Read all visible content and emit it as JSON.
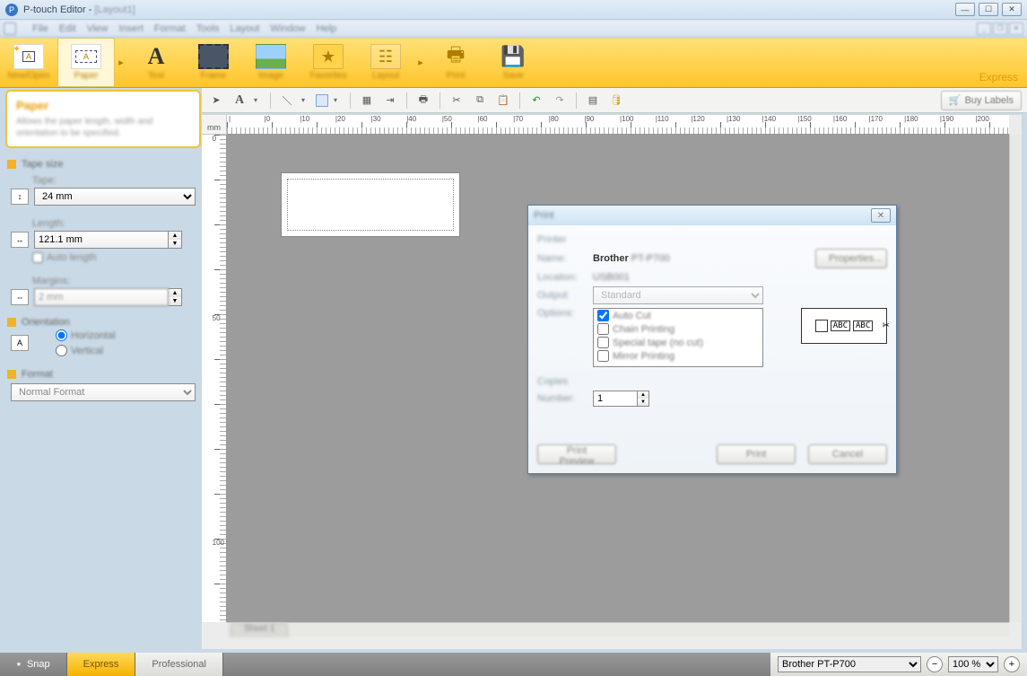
{
  "titlebar": {
    "app": "P-touch Editor",
    "doc": "[Layout1]"
  },
  "menus": [
    "File",
    "Edit",
    "View",
    "Insert",
    "Format",
    "Tools",
    "Layout",
    "Window",
    "Help"
  ],
  "ribbon": {
    "primary": [
      {
        "id": "new",
        "label": "New/Open"
      },
      {
        "id": "paper",
        "label": "Paper"
      }
    ],
    "tools": [
      {
        "id": "text",
        "label": "Text"
      },
      {
        "id": "frame",
        "label": "Frame"
      },
      {
        "id": "image",
        "label": "Image"
      },
      {
        "id": "favorites",
        "label": "Favorites"
      },
      {
        "id": "layout",
        "label": "Layout"
      }
    ],
    "actions": [
      {
        "id": "print",
        "label": "Print"
      },
      {
        "id": "save",
        "label": "Save"
      }
    ],
    "mode": "Express"
  },
  "buy_labels": "Buy Labels",
  "left": {
    "card_title": "Paper",
    "card_desc": "Allows the paper length, width and orientation to be specified.",
    "tape_size_section": "Tape size",
    "tape_label": "Tape:",
    "tape_value": "24 mm",
    "length_label": "Length:",
    "length_value": "121.1 mm",
    "auto_length": "Auto length",
    "margins_label": "Margins:",
    "margins_value": "2 mm",
    "orientation_section": "Orientation",
    "orientation_h": "Horizontal",
    "orientation_v": "Vertical",
    "format_section": "Format",
    "format_value": "Normal Format"
  },
  "ruler": {
    "units": "mm",
    "h_ticks": [
      "|",
      "|0",
      "|10",
      "|20",
      "|30",
      "|40",
      "|50",
      "|60",
      "|70",
      "|80",
      "|90",
      "|100",
      "|110",
      "|120",
      "|130",
      "|140",
      "|150",
      "|160",
      "|170",
      "|180",
      "|190",
      "|200"
    ],
    "v_ticks": [
      "0",
      "",
      "",
      "",
      "50",
      "",
      "",
      "",
      "",
      "100"
    ]
  },
  "sheet_tab": "Sheet 1",
  "dialog": {
    "title": "Print",
    "printer_section": "Printer",
    "name_k": "Name:",
    "name_v": "Brother",
    "name_vblur": "PT-P700",
    "location_k": "Location:",
    "location_v": "USB001",
    "properties": "Properties...",
    "output_k": "Output:",
    "output_v": "Standard",
    "options_k": "Options:",
    "options": [
      {
        "label": "Auto Cut",
        "checked": true
      },
      {
        "label": "Chain Printing",
        "checked": false
      },
      {
        "label": "Special tape (no cut)",
        "checked": false
      },
      {
        "label": "Mirror Printing",
        "checked": false
      }
    ],
    "preview_tag": "ABC",
    "copies_section": "Copies",
    "number_k": "Number:",
    "number_v": "1",
    "btn_preview": "Print Preview",
    "btn_print": "Print",
    "btn_cancel": "Cancel"
  },
  "status": {
    "snap": "Snap",
    "express": "Express",
    "professional": "Professional",
    "printer": "Brother",
    "printer_blur": "PT-P700",
    "zoom": "100 %"
  }
}
